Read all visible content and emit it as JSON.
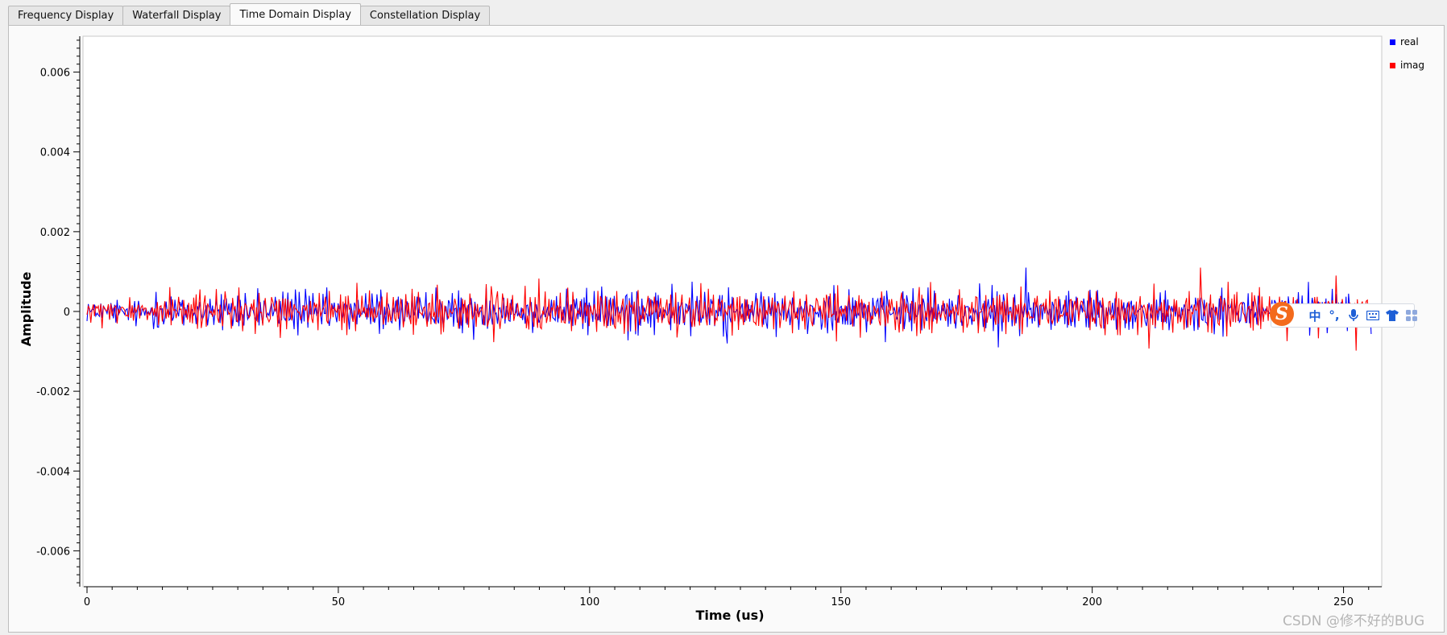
{
  "tabs": [
    {
      "label": "Frequency Display",
      "active": false
    },
    {
      "label": "Waterfall Display",
      "active": false
    },
    {
      "label": "Time Domain Display",
      "active": true
    },
    {
      "label": "Constellation Display",
      "active": false
    }
  ],
  "chart_data": {
    "type": "line",
    "title": "",
    "xlabel": "Time (us)",
    "ylabel": "Amplitude",
    "xlim": [
      0,
      256
    ],
    "ylim": [
      -0.0069,
      0.0069
    ],
    "x_ticks": [
      0,
      50,
      100,
      150,
      200,
      250
    ],
    "y_ticks": [
      {
        "value": 0.006,
        "label": "0.006"
      },
      {
        "value": 0.004,
        "label": "0.004"
      },
      {
        "value": 0.002,
        "label": "0.002"
      },
      {
        "value": 0,
        "label": "0"
      },
      {
        "value": -0.002,
        "label": "-0.002"
      },
      {
        "value": -0.004,
        "label": "-0.004"
      },
      {
        "value": -0.006,
        "label": "-0.006"
      }
    ],
    "legend_position": "top-right",
    "series": [
      {
        "name": "real",
        "color": "#0000ff",
        "description": "noise centered at 0, amplitude roughly within ±0.0009",
        "peak": 0.0011,
        "trough": -0.0009
      },
      {
        "name": "imag",
        "color": "#ff0000",
        "description": "noise centered at 0, amplitude roughly within ±0.0009",
        "peak": 0.0011,
        "trough": -0.001
      }
    ]
  },
  "ime_toolbar": {
    "logo": "S",
    "icons": [
      "chinese-mode-icon",
      "punctuation-icon",
      "microphone-icon",
      "keyboard-icon",
      "skin-shirt-icon",
      "apps-grid-icon"
    ],
    "chinese_label": "中",
    "punct_label": "°,"
  },
  "watermark": "CSDN @修不好的BUG"
}
